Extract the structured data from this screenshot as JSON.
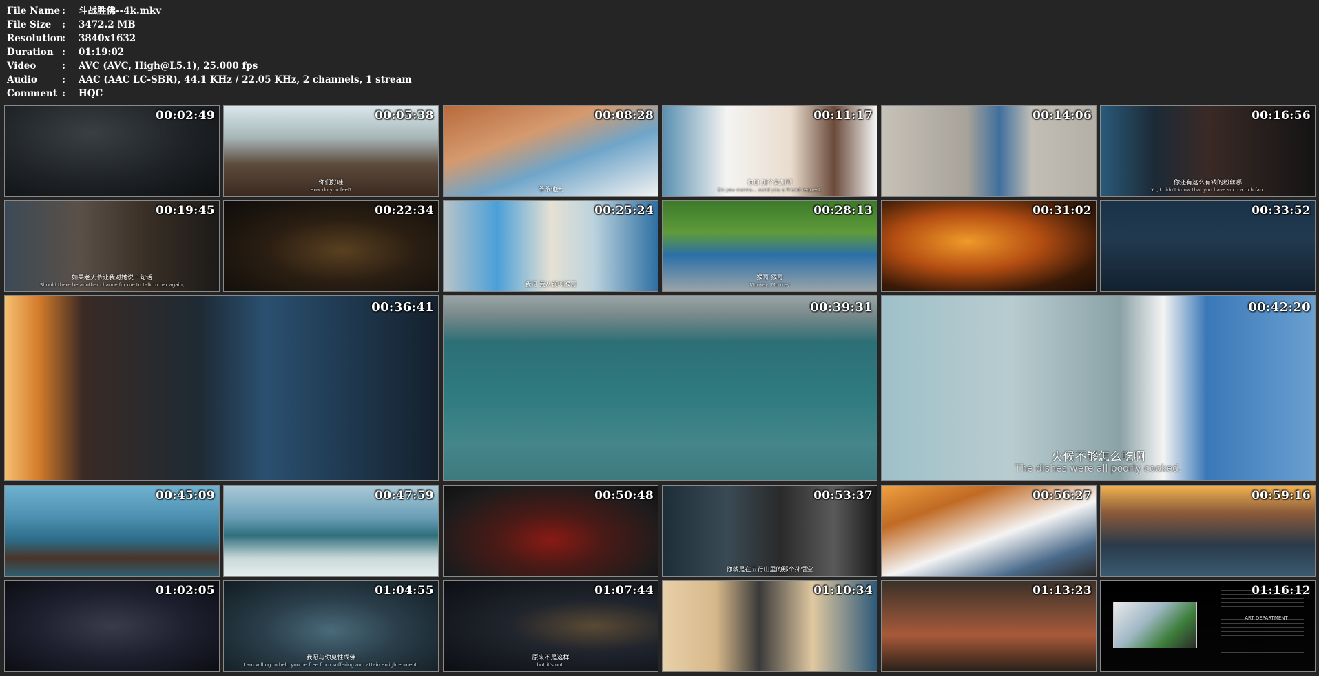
{
  "info": [
    {
      "label": "File Name",
      "value": "斗战胜佛--4k.mkv"
    },
    {
      "label": "File Size",
      "value": "3472.2 MB"
    },
    {
      "label": "Resolution",
      "value": "3840x1632"
    },
    {
      "label": "Duration",
      "value": "01:19:02"
    },
    {
      "label": "Video",
      "value": "AVC (AVC, High@L5.1), 25.000 fps"
    },
    {
      "label": "Audio",
      "value": "AAC (AAC LC-SBR), 44.1 KHz / 22.05 KHz, 2 channels, 1 stream"
    },
    {
      "label": "Comment",
      "value": "HQC"
    }
  ],
  "colon": ":",
  "thumbnails": [
    {
      "time": "00:02:49",
      "sub_cn": "",
      "sub_en": ""
    },
    {
      "time": "00:05:38",
      "sub_cn": "你们好哇",
      "sub_en": "How do you feel?"
    },
    {
      "time": "00:08:28",
      "sub_cn": "爷爷他大",
      "sub_en": ""
    },
    {
      "time": "00:11:17",
      "sub_cn": "你加 加个友加呗",
      "sub_en": "Do you wanna... send you a friend request."
    },
    {
      "time": "00:14:06",
      "sub_cn": "",
      "sub_en": ""
    },
    {
      "time": "00:16:56",
      "sub_cn": "你还有这么有钱的粉丝哪",
      "sub_en": "Yo, I didn't know that you have such a rich fan."
    },
    {
      "time": "00:19:45",
      "sub_cn": "如果老天爷让我对她说一句话",
      "sub_en": "Should there be another chance for me to talk to her again,"
    },
    {
      "time": "00:22:34",
      "sub_cn": "",
      "sub_en": ""
    },
    {
      "time": "00:25:24",
      "sub_cn": "我呀 我从前叫猴哥",
      "sub_en": ""
    },
    {
      "time": "00:28:13",
      "sub_cn": "猴哥 猴哥",
      "sub_en": "Monkey, Monkey"
    },
    {
      "time": "00:31:02",
      "sub_cn": "",
      "sub_en": ""
    },
    {
      "time": "00:33:52",
      "sub_cn": "",
      "sub_en": ""
    },
    {
      "time": "00:36:41",
      "sub_cn": "",
      "sub_en": ""
    },
    {
      "time": "00:39:31",
      "sub_cn": "",
      "sub_en": ""
    },
    {
      "time": "00:42:20",
      "sub_cn": "火候不够怎么吃啊",
      "sub_en": "The dishes were all poorly cooked."
    },
    {
      "time": "00:45:09",
      "sub_cn": "",
      "sub_en": ""
    },
    {
      "time": "00:47:59",
      "sub_cn": "",
      "sub_en": ""
    },
    {
      "time": "00:50:48",
      "sub_cn": "",
      "sub_en": ""
    },
    {
      "time": "00:53:37",
      "sub_cn": "你就是在五行山里的那个孙悟空",
      "sub_en": ""
    },
    {
      "time": "00:56:27",
      "sub_cn": "",
      "sub_en": ""
    },
    {
      "time": "00:59:16",
      "sub_cn": "",
      "sub_en": ""
    },
    {
      "time": "01:02:05",
      "sub_cn": "",
      "sub_en": ""
    },
    {
      "time": "01:04:55",
      "sub_cn": "我愿与你见性成佛",
      "sub_en": "I am willing to help you be free from suffering and attain enlightenment."
    },
    {
      "time": "01:07:44",
      "sub_cn": "原来不是这样",
      "sub_en": "but it's not."
    },
    {
      "time": "01:10:34",
      "sub_cn": "",
      "sub_en": ""
    },
    {
      "time": "01:13:23",
      "sub_cn": "",
      "sub_en": ""
    },
    {
      "time": "01:16:12",
      "sub_cn": "",
      "sub_en": "ART DEPARTMENT"
    }
  ]
}
